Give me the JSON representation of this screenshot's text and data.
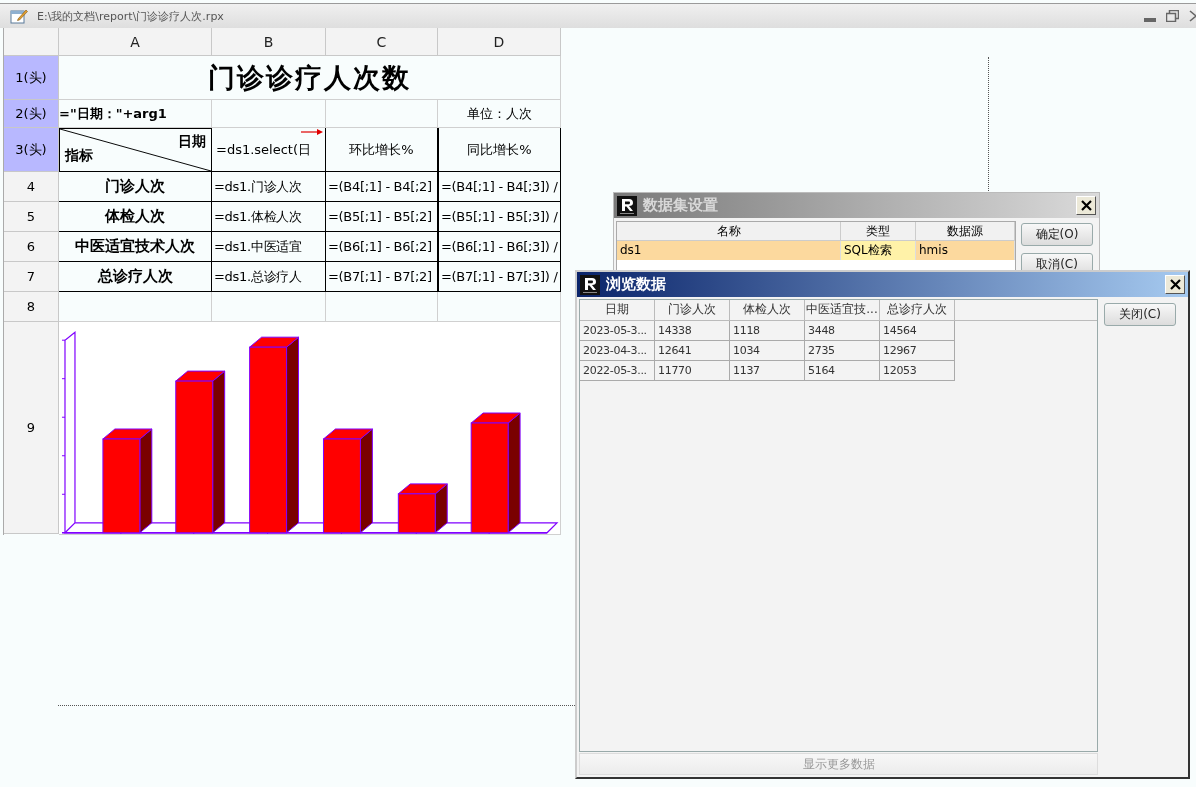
{
  "window": {
    "title": "E:\\我的文档\\report\\门诊诊疗人次.rpx"
  },
  "sheet": {
    "columns": [
      "A",
      "B",
      "C",
      "D"
    ],
    "rows": [
      {
        "label": "1(头)",
        "kind": "title",
        "text": "门诊诊疗人次数"
      },
      {
        "label": "2(头)",
        "kind": "caption",
        "left": "=\"日期：\"+arg1",
        "right": "单位：人次"
      },
      {
        "label": "3(头)",
        "kind": "header",
        "corner_top": "日期",
        "corner_bottom": "指标",
        "cells": [
          "=ds1.select(日",
          "环比增长%",
          "同比增长%"
        ]
      },
      {
        "label": "4",
        "kind": "data",
        "cells": [
          "门诊人次",
          "=ds1.门诊人次",
          "=(B4[;1] - B4[;2]",
          "=(B4[;1] - B4[;3]) /"
        ]
      },
      {
        "label": "5",
        "kind": "data",
        "cells": [
          "体检人次",
          "=ds1.体检人次",
          "=(B5[;1] - B5[;2]",
          "=(B5[;1] - B5[;3]) /"
        ]
      },
      {
        "label": "6",
        "kind": "data",
        "cells": [
          "中医适宜技术人次",
          "=ds1.中医适宜",
          "=(B6[;1] - B6[;2]",
          "=(B6[;1] - B6[;3]) /"
        ]
      },
      {
        "label": "7",
        "kind": "data",
        "cells": [
          "总诊疗人次",
          "=ds1.总诊疗人",
          "=(B7[;1] - B7[;2]",
          "=(B7[;1] - B7[;3]) /"
        ]
      },
      {
        "label": "8",
        "kind": "blank"
      },
      {
        "label": "9",
        "kind": "chart"
      }
    ]
  },
  "dataset_dialog": {
    "title": "数据集设置",
    "columns": [
      "名称",
      "类型",
      "数据源"
    ],
    "rows": [
      {
        "cells": [
          "ds1",
          "SQL检索",
          "hmis"
        ],
        "selected": true
      }
    ],
    "buttons": [
      "确定(O)",
      "取消(C)"
    ]
  },
  "browse_dialog": {
    "title": "浏览数据",
    "columns": [
      "日期",
      "门诊人次",
      "体检人次",
      "中医适宜技...",
      "总诊疗人次"
    ],
    "rows": [
      {
        "cells": [
          "2023-05-3...",
          "14338",
          "1118",
          "3448",
          "14564"
        ]
      },
      {
        "cells": [
          "2023-04-3...",
          "12641",
          "1034",
          "2735",
          "12967"
        ]
      },
      {
        "cells": [
          "2022-05-3...",
          "11770",
          "1137",
          "5164",
          "12053"
        ]
      }
    ],
    "close_button": "关闭(C)",
    "more_button": {
      "label": "显示更多数据",
      "disabled": true
    }
  }
}
